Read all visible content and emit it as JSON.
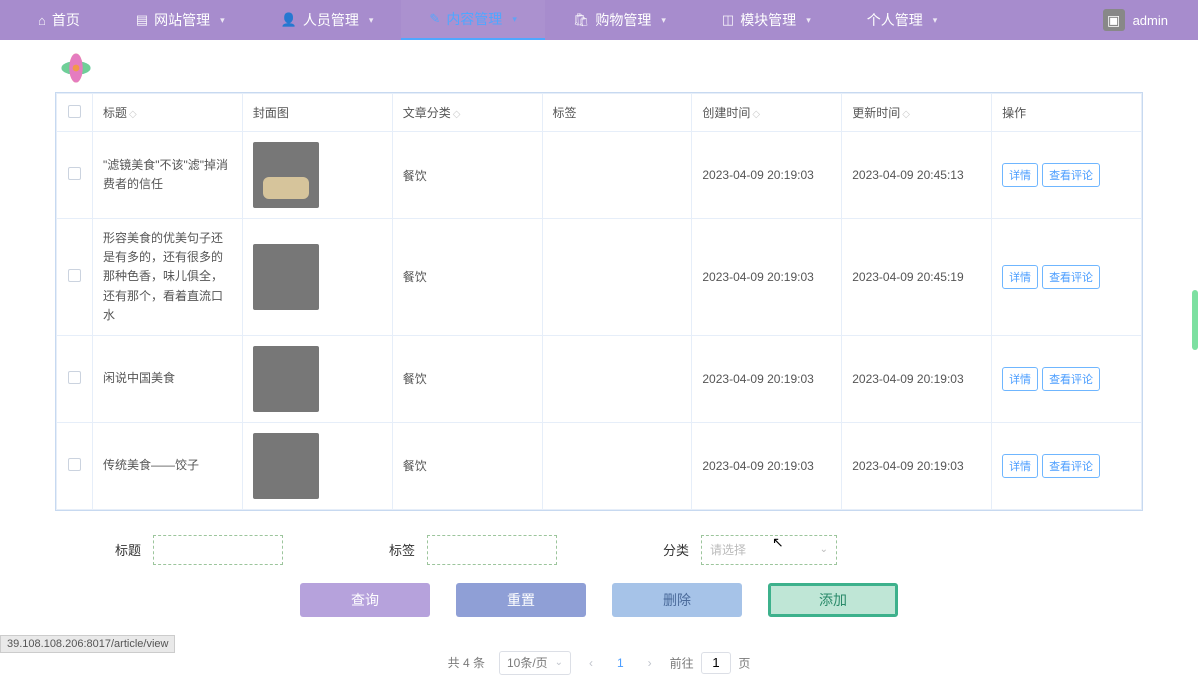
{
  "nav": {
    "items": [
      {
        "icon": "⌂",
        "label": "首页"
      },
      {
        "icon": "▤",
        "label": "网站管理",
        "caret": true
      },
      {
        "icon": "👤",
        "label": "人员管理",
        "caret": true
      },
      {
        "icon": "✎",
        "label": "内容管理",
        "caret": true,
        "active": true
      },
      {
        "icon": "🛍",
        "label": "购物管理",
        "caret": true
      },
      {
        "icon": "◫",
        "label": "模块管理",
        "caret": true
      },
      {
        "icon": "",
        "label": "个人管理",
        "caret": true
      }
    ],
    "user": "admin"
  },
  "table": {
    "headers": {
      "title": "标题",
      "cover": "封面图",
      "category": "文章分类",
      "tag": "标签",
      "created": "创建时间",
      "updated": "更新时间",
      "ops": "操作"
    },
    "ops": {
      "detail": "详情",
      "comments": "查看评论"
    },
    "rows": [
      {
        "title": "\"滤镜美食\"不该\"滤\"掉消费者的信任",
        "category": "餐饮",
        "tag": "",
        "created": "2023-04-09 20:19:03",
        "updated": "2023-04-09 20:45:13",
        "thumb": "thumb1"
      },
      {
        "title": "形容美食的优美句子还是有多的，还有很多的那种色香，味儿俱全，还有那个，看着直流口水",
        "category": "餐饮",
        "tag": "",
        "created": "2023-04-09 20:19:03",
        "updated": "2023-04-09 20:45:19",
        "thumb": "thumb2"
      },
      {
        "title": "闲说中国美食",
        "category": "餐饮",
        "tag": "",
        "created": "2023-04-09 20:19:03",
        "updated": "2023-04-09 20:19:03",
        "thumb": "thumb3"
      },
      {
        "title": "传统美食——饺子",
        "category": "餐饮",
        "tag": "",
        "created": "2023-04-09 20:19:03",
        "updated": "2023-04-09 20:19:03",
        "thumb": "thumb4"
      }
    ]
  },
  "filters": {
    "title_label": "标题",
    "tag_label": "标签",
    "category_label": "分类",
    "category_placeholder": "请选择"
  },
  "actions": {
    "query": "查询",
    "reset": "重置",
    "delete": "删除",
    "add": "添加"
  },
  "pager": {
    "total": "共 4 条",
    "perpage": "10条/页",
    "current": "1",
    "goto_prefix": "前往",
    "goto_value": "1",
    "goto_suffix": "页"
  },
  "statusbar": "39.108.108.206:8017/article/view"
}
